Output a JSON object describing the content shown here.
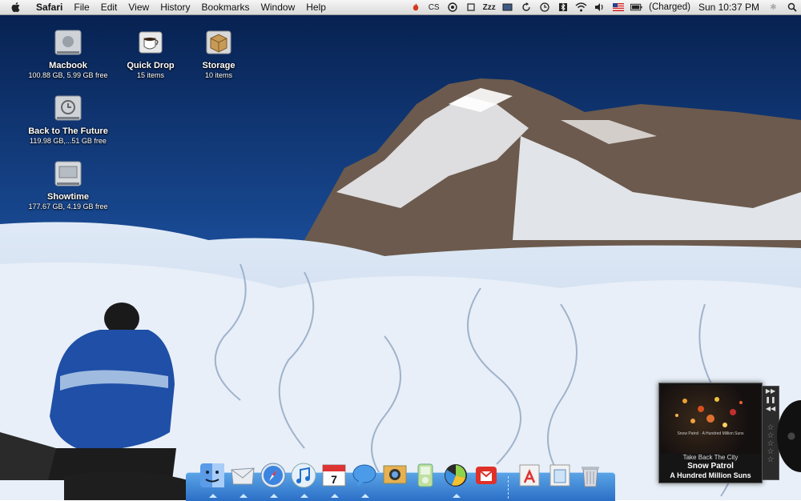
{
  "menubar": {
    "app": "Safari",
    "menus": [
      "File",
      "Edit",
      "View",
      "History",
      "Bookmarks",
      "Window",
      "Help"
    ],
    "status_icons": [
      "fire-icon",
      "cs-icon",
      "target-icon",
      "frame-icon",
      "sleep-icon",
      "screen-icon",
      "sync-icon",
      "timemachine-icon",
      "bluetooth-icon",
      "wifi-icon",
      "volume-icon",
      "flag-icon",
      "battery-icon"
    ],
    "sleep_text": "Zzz",
    "cs_text": "CS",
    "battery_text": "(Charged)",
    "clock": "Sun 10:37 PM"
  },
  "desktop": {
    "icons": [
      {
        "name": "Macbook",
        "info": "100.88 GB, 5.99 GB free"
      },
      {
        "name": "Quick Drop",
        "info": "15 items"
      },
      {
        "name": "Storage",
        "info": "10 items"
      },
      {
        "name": "Back to The Future",
        "info": "119.98 GB,...51 GB free"
      },
      {
        "name": "Showtime",
        "info": "177.67 GB, 4.19 GB free"
      }
    ]
  },
  "dock": {
    "apps": [
      "finder",
      "mail",
      "safari",
      "itunes",
      "ical",
      "ichat",
      "iphoto",
      "preview",
      "istat",
      "gmail",
      "applications-folder",
      "documents-folder",
      "trash"
    ],
    "ical_day": "7"
  },
  "now_playing": {
    "track": "Take Back The City",
    "artist": "Snow Patrol",
    "album": "A Hundred Million Suns",
    "art_caption": "Snow Patrol · A Hundred Million Suns"
  },
  "colors": {
    "sky_top": "#0b2f6e",
    "sky_bottom": "#2c6fc7",
    "dock": "#3a84d6",
    "snow": "#e6eef8"
  }
}
